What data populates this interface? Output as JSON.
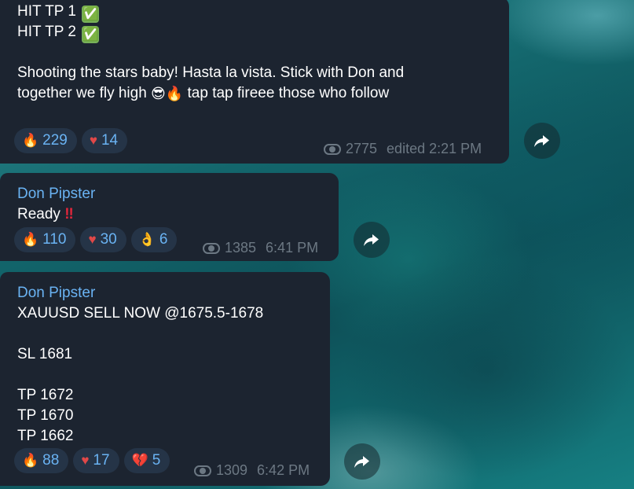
{
  "messages": [
    {
      "lines": [
        "HIT TP 1",
        "HIT TP 2",
        "",
        "Shooting the stars baby! Hasta la vista. Stick with Don and",
        "together we fly high",
        "tap tap fireee those who follow"
      ],
      "line_emojis": [
        "✅",
        "✅",
        "😎🔥"
      ],
      "reactions": [
        {
          "icon": "🔥",
          "count": "229"
        },
        {
          "icon": "♥",
          "count": "14"
        }
      ],
      "views": "2775",
      "time": "edited 2:21 PM"
    },
    {
      "sender": "Don Pipster",
      "text": "Ready",
      "text_emoji": "‼",
      "reactions": [
        {
          "icon": "🔥",
          "count": "110"
        },
        {
          "icon": "♥",
          "count": "30"
        },
        {
          "icon": "👌",
          "count": "6"
        }
      ],
      "views": "1385",
      "time": "6:41 PM"
    },
    {
      "sender": "Don Pipster",
      "lines": [
        "XAUUSD SELL NOW @1675.5-1678",
        "",
        "SL 1681",
        "",
        "TP 1672",
        "TP 1670",
        "TP 1662"
      ],
      "reactions": [
        {
          "icon": "🔥",
          "count": "88"
        },
        {
          "icon": "♥",
          "count": "17"
        },
        {
          "icon": "💔",
          "count": "5"
        }
      ],
      "views": "1309",
      "time": "6:42 PM"
    }
  ],
  "colors": {
    "bubble": "#1c2430",
    "sender": "#6ab3f3",
    "reaction_bg": "#253447",
    "meta": "#6c7883"
  },
  "icons": {
    "forward": "share-arrow-icon",
    "views": "eye-icon"
  }
}
